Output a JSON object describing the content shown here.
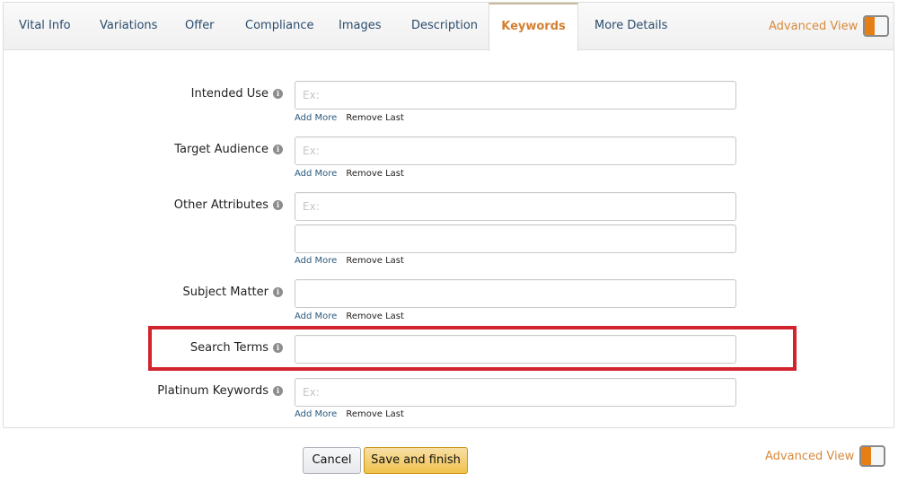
{
  "tabs": [
    {
      "label": "Vital Info",
      "active": false
    },
    {
      "label": "Variations",
      "active": false
    },
    {
      "label": "Offer",
      "active": false
    },
    {
      "label": "Compliance",
      "active": false
    },
    {
      "label": "Images",
      "active": false
    },
    {
      "label": "Description",
      "active": false
    },
    {
      "label": "Keywords",
      "active": true
    },
    {
      "label": "More Details",
      "active": false
    }
  ],
  "advanced_view": {
    "label": "Advanced View",
    "enabled": true
  },
  "colors": {
    "accent": "#e67e16",
    "highlight_border": "#d1242f",
    "primary_button": "#f0c14b",
    "link": "#2a5a7e"
  },
  "info_icon_glyph": "i",
  "fields": {
    "intended_use": {
      "label": "Intended Use",
      "placeholder": "Ex:",
      "value": ""
    },
    "target_audience": {
      "label": "Target Audience",
      "placeholder": "Ex:",
      "value": ""
    },
    "other_attributes": {
      "label": "Other Attributes",
      "placeholder": "Ex:",
      "value": "",
      "second_value": ""
    },
    "subject_matter": {
      "label": "Subject Matter",
      "placeholder": "",
      "value": ""
    },
    "search_terms": {
      "label": "Search Terms",
      "placeholder": "",
      "value": ""
    },
    "platinum_keywords": {
      "label": "Platinum Keywords",
      "placeholder": "Ex:",
      "value": ""
    }
  },
  "row_links": {
    "add_more": "Add More",
    "remove_last": "Remove Last"
  },
  "footer": {
    "cancel_label": "Cancel",
    "save_label": "Save and finish"
  }
}
